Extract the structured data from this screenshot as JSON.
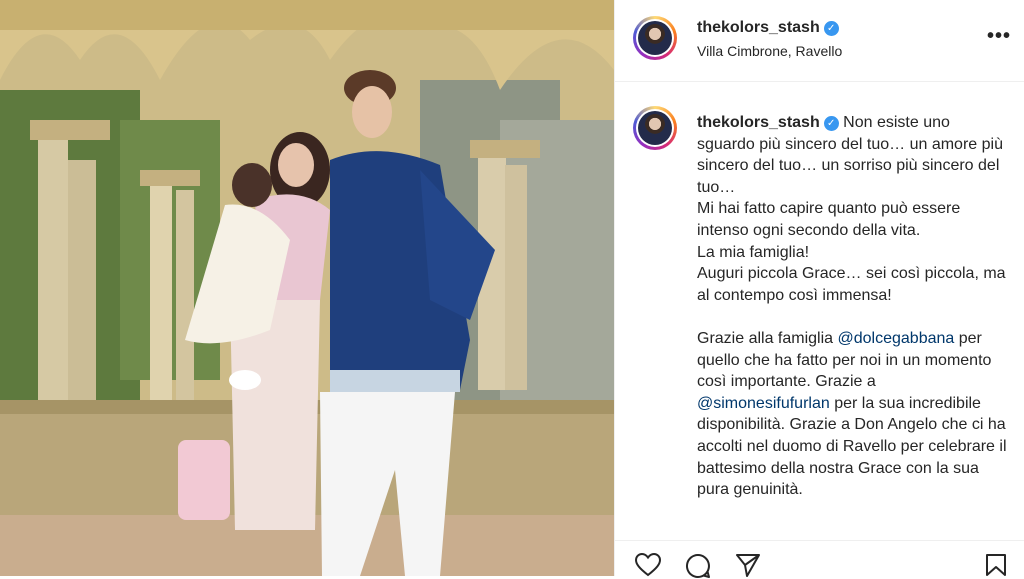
{
  "post": {
    "username": "thekolors_stash",
    "verified_icon": "verified-badge-icon",
    "location": "Villa Cimbrone, Ravello",
    "more_icon": "more-options-icon",
    "more_label": "•••"
  },
  "caption": {
    "username": "thekolors_stash",
    "text_1": " Non esiste uno sguardo più sincero del tuo… un amore più sincero del tuo… un sorriso più sincero del tuo…\nMi hai fatto capire quanto può essere intenso ogni secondo della vita.\nLa mia famiglia!\nAuguri piccola Grace… sei così piccola, ma al contempo così immensa!\n\nGrazie alla famiglia ",
    "mention_1": "@dolcegabbana",
    "text_2": " per quello che ha fatto per noi in un momento così importante. Grazie a ",
    "mention_2": "@simonesifufurlan",
    "text_3": " per la sua incredibile disponibilità. Grazie a Don Angelo che ci ha accolti nel duomo di Ravello per celebrare il battesimo della nostra Grace con la sua pura genuinità."
  },
  "actions": {
    "like_icon": "heart-icon",
    "comment_icon": "comment-icon",
    "share_icon": "share-icon",
    "save_icon": "bookmark-icon"
  },
  "colors": {
    "verified": "#3897f0",
    "mention": "#00376b",
    "text": "#262626",
    "border": "#efefef"
  }
}
